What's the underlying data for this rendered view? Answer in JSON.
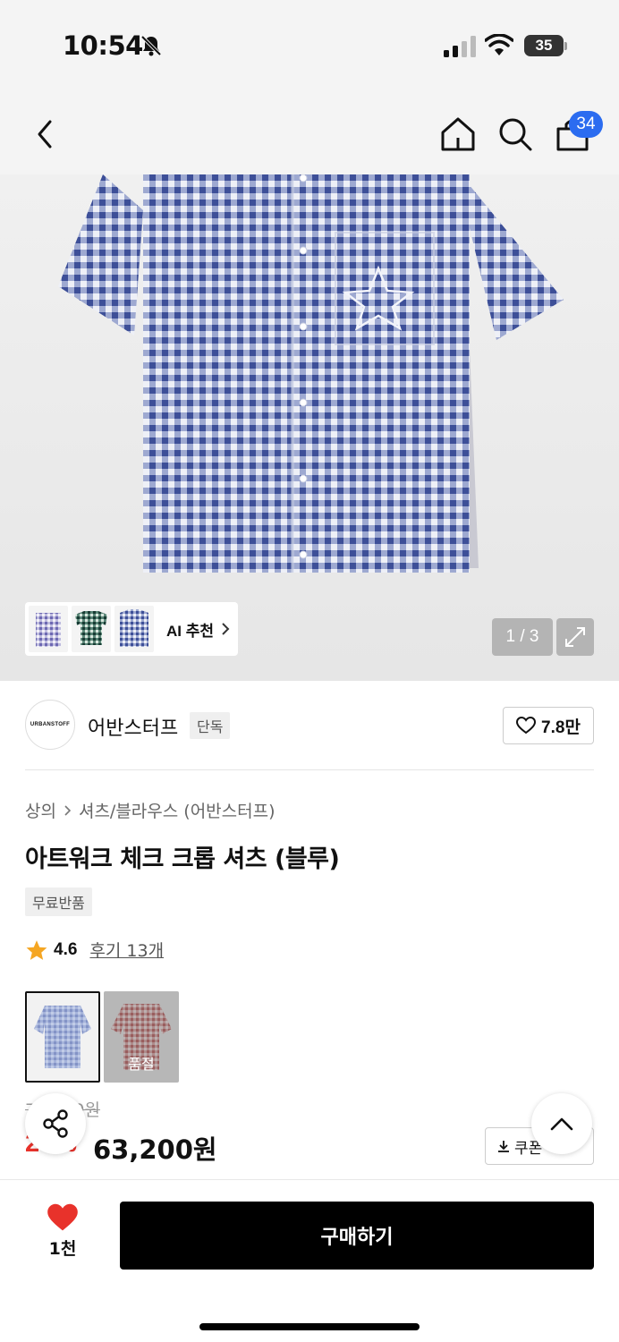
{
  "status_bar": {
    "time": "10:54",
    "battery": "35"
  },
  "nav": {
    "cart_count": "34"
  },
  "gallery": {
    "ai_label": "AI 추천",
    "counter": "1 / 3"
  },
  "brand": {
    "logo_text": "URBANSTOFF",
    "name": "어반스터프",
    "tag": "단독",
    "likes": "7.8만"
  },
  "product": {
    "breadcrumb": [
      "상의",
      "셔츠/블라우스 (어반스터프)"
    ],
    "title": "아트워크 체크 크롭 셔츠 (블루)",
    "badge": "무료반품",
    "rating": "4.6",
    "reviews": "후기 13개",
    "colors": [
      {
        "name": "블루",
        "selected": true
      },
      {
        "name": "레드",
        "status": "품절"
      }
    ],
    "original_price": "79,000원",
    "discount": "20%",
    "price": "63,200원",
    "coupon": "쿠폰"
  },
  "bottom": {
    "wish_count": "1천",
    "buy_label": "구매하기"
  },
  "colors": {
    "brand_blue": "#2b6cf0",
    "wish_red": "#e8322b",
    "buy_black": "#000000",
    "star": "#f5a623"
  }
}
